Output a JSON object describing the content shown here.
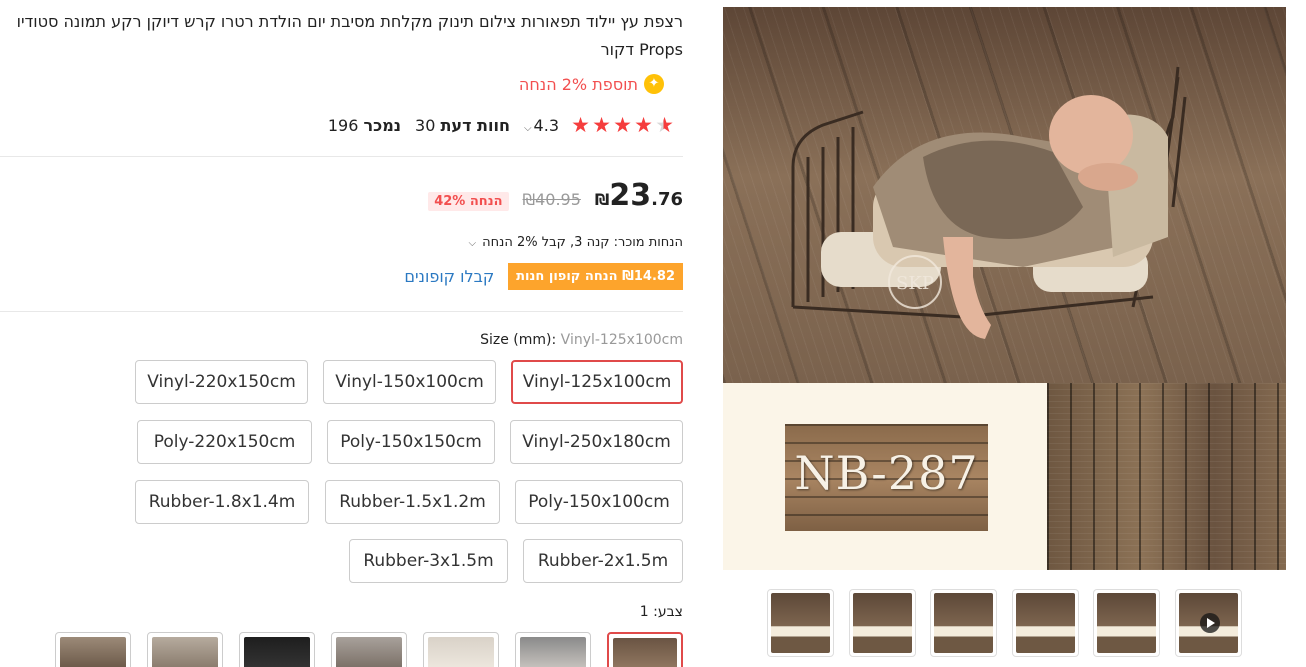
{
  "product": {
    "title": "רצפת עץ יילוד תפאורות צילום תינוק מקלחת מסיבת יום הולדת רטרו קרש דיוקן רקע תמונה סטודיו Props דקור",
    "bonus_text": "תוספת 2% הנחה",
    "rating": "4.3",
    "reviews_count": "30",
    "reviews_label": "חוות דעת",
    "sold_count": "196",
    "sold_label": "נמכר",
    "stars_filled": 4.3,
    "stars_total": 5
  },
  "price": {
    "integer": "23",
    "decimal": ".76",
    "currency": "₪",
    "original": "₪40.95",
    "discount_badge": "הנחה 42%"
  },
  "promotions": {
    "seller_discount": "הנחות מוכר: קנה 3, קבל 2% הנחה",
    "coupon": "₪14.82 הנחה קופון חנות",
    "coupon_link": "קבלו קופונים"
  },
  "size": {
    "label": "Size (mm): ",
    "selected_value": "Vinyl-125x100cm",
    "options": [
      "Vinyl-125x100cm",
      "Vinyl-150x100cm",
      "Vinyl-220x150cm",
      "Vinyl-250x180cm",
      "Poly-150x150cm",
      "Poly-220x150cm",
      "Poly-150x100cm",
      "Rubber-1.5x1.2m",
      "Rubber-1.8x1.4m",
      "Rubber-2x1.5m",
      "Rubber-3x1.5m"
    ]
  },
  "color": {
    "label": "צבע: 1",
    "options_count": 7,
    "selected_index": 0
  },
  "gallery": {
    "main_code": "NB-287",
    "thumb_count": 6,
    "video_thumb_index": 5
  },
  "colors": {
    "accent_red": "#f24f4f",
    "coupon_orange": "#fda42c",
    "link_blue": "#2b79c2",
    "star_red": "#f53d3d",
    "selected_border": "#e04a4a"
  }
}
